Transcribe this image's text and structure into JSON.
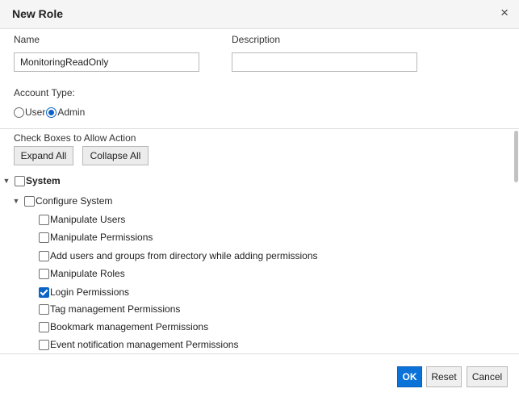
{
  "dialog": {
    "title": "New Role",
    "close_icon": "×"
  },
  "form": {
    "name_label": "Name",
    "name_value": "MonitoringReadOnly",
    "description_label": "Description",
    "description_value": "",
    "account_type_label": "Account Type:",
    "account_types": [
      {
        "label": "User",
        "selected": false
      },
      {
        "label": "Admin",
        "selected": true
      }
    ]
  },
  "permissions": {
    "instruction": "Check Boxes to Allow Action",
    "expand_all": "Expand All",
    "collapse_all": "Collapse All",
    "tree": [
      {
        "label": "System",
        "level": 0,
        "expanded": true,
        "checked": false,
        "bold": true
      },
      {
        "label": "Configure System",
        "level": 1,
        "expanded": true,
        "checked": false
      },
      {
        "label": "Manipulate Users",
        "level": 2,
        "checked": false
      },
      {
        "label": "Manipulate Permissions",
        "level": 2,
        "checked": false
      },
      {
        "label": "Add users and groups from directory while adding permissions",
        "level": 2,
        "checked": false
      },
      {
        "label": "Manipulate Roles",
        "level": 2,
        "checked": false
      },
      {
        "label": "Login Permissions",
        "level": 2,
        "checked": true
      },
      {
        "label": "Tag management Permissions",
        "level": 2,
        "checked": false
      },
      {
        "label": "Bookmark management Permissions",
        "level": 2,
        "checked": false
      },
      {
        "label": "Event notification management Permissions",
        "level": 2,
        "checked": false
      }
    ]
  },
  "footer": {
    "ok": "OK",
    "reset": "Reset",
    "cancel": "Cancel"
  },
  "colors": {
    "accent": "#0b72d8"
  }
}
